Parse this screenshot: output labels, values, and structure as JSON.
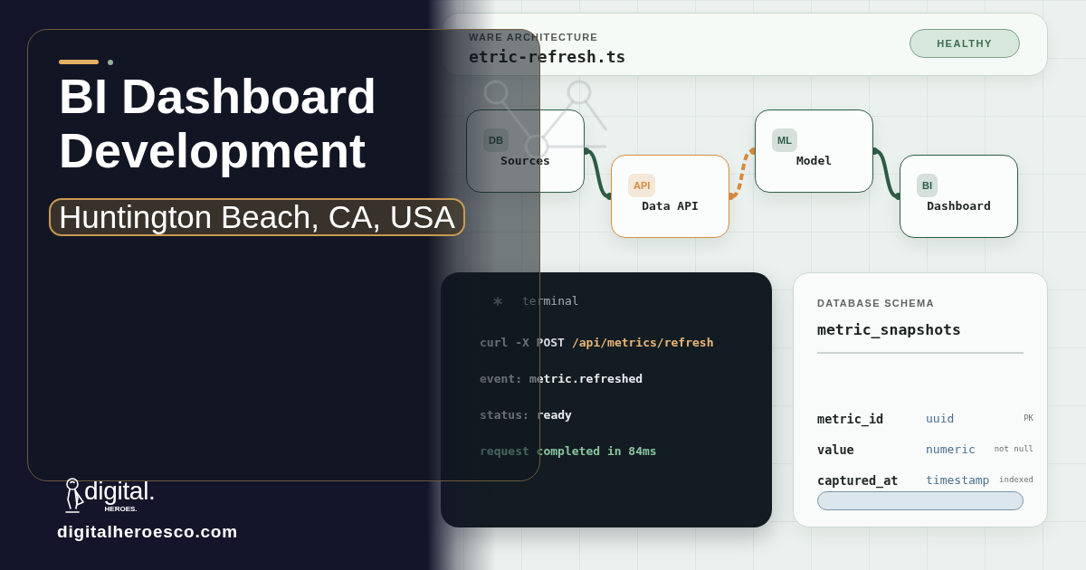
{
  "hero": {
    "title": "BI Dashboard Development",
    "location": "Huntington Beach, CA, USA"
  },
  "architecture": {
    "label": "WARE ARCHITECTURE",
    "file": "etric-refresh.ts",
    "status": "HEALTHY"
  },
  "diagram": {
    "nodes": [
      {
        "badge": "DB",
        "label": "Sources",
        "color": "#2f5c47"
      },
      {
        "badge": "API",
        "label": "Data API",
        "color": "#d98b3e"
      },
      {
        "badge": "ML",
        "label": "Model",
        "color": "#2f5c47"
      },
      {
        "badge": "BI",
        "label": "Dashboard",
        "color": "#2f5c47"
      }
    ],
    "links": [
      {
        "kind": "solid",
        "color": "#2f5c47"
      },
      {
        "kind": "dashed",
        "color": "#d98b3e"
      },
      {
        "kind": "solid",
        "color": "#2f5c47"
      }
    ]
  },
  "terminal": {
    "title": "terminal",
    "lines": [
      {
        "kind": "command",
        "prefix": "curl -X POST",
        "text": "/api/metrics/refresh"
      },
      {
        "kind": "output",
        "prefix": "event:",
        "text": "metric.refreshed"
      },
      {
        "kind": "output",
        "prefix": "status:",
        "text": "ready"
      },
      {
        "kind": "success",
        "text": "request completed in 84ms"
      }
    ]
  },
  "schema": {
    "label": "DATABASE SCHEMA",
    "table": "metric_snapshots",
    "columns": [
      {
        "name": "metric_id",
        "type": "uuid",
        "note": "PK"
      },
      {
        "name": "value",
        "type": "numeric",
        "note": "not null"
      },
      {
        "name": "captured_at",
        "type": "timestamp",
        "note": "indexed"
      }
    ]
  },
  "brand": {
    "logo": "digital.",
    "logo_tagline": "HEROES.",
    "website": "digitalheroesco.com"
  }
}
